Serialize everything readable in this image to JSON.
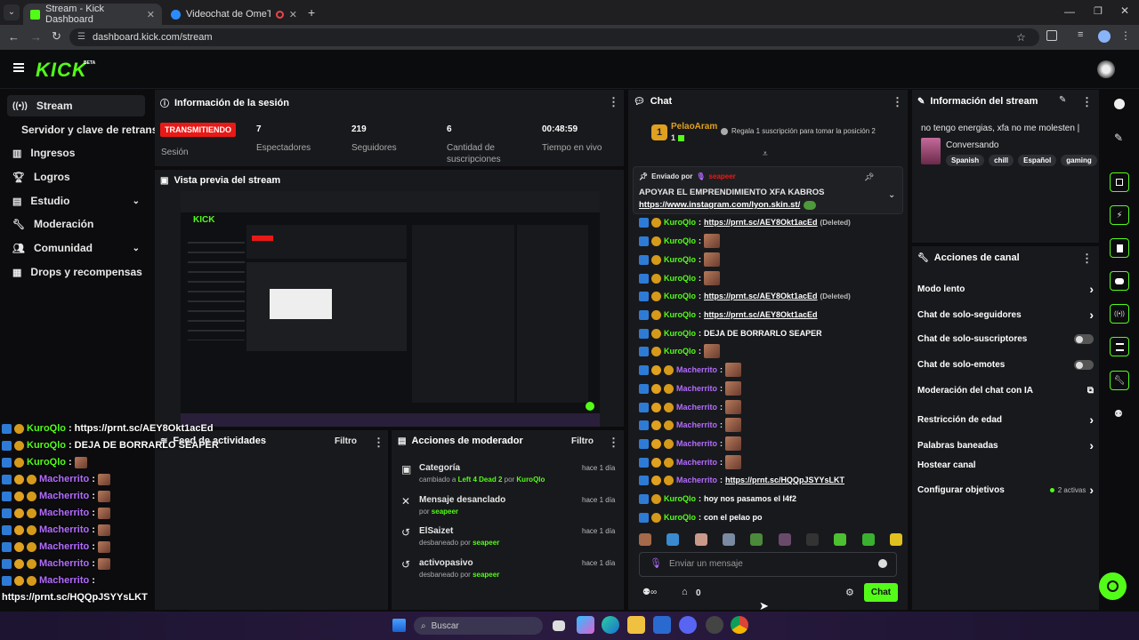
{
  "browser": {
    "tabs": [
      {
        "title": "Stream - Kick Dashboard"
      },
      {
        "title": "Videochat de OmeTV: una"
      }
    ],
    "url": "dashboard.kick.com/stream"
  },
  "brand": {
    "logo": "KICK",
    "beta": "BETA",
    "accent": "#53fc18"
  },
  "sidebar": {
    "items": [
      {
        "label": "Stream",
        "icon": "broadcast-icon"
      },
      {
        "label": "Servidor y clave de retransm"
      },
      {
        "label": "Ingresos",
        "icon": "chart-icon"
      },
      {
        "label": "Logros",
        "icon": "trophy-icon"
      },
      {
        "label": "Estudio",
        "icon": "studio-icon"
      },
      {
        "label": "Moderación",
        "icon": "wrench-icon"
      },
      {
        "label": "Comunidad",
        "icon": "community-icon"
      },
      {
        "label": "Drops y recompensas",
        "icon": "drops-icon"
      }
    ]
  },
  "session": {
    "title": "Información de la sesión",
    "status": "TRANSMITIENDO",
    "status_label": "Sesión",
    "stats": [
      {
        "value": "7",
        "label": "Espectadores"
      },
      {
        "value": "219",
        "label": "Seguidores"
      },
      {
        "value": "6",
        "label": "Cantidad de suscripciones"
      },
      {
        "value": "00:48:59",
        "label": "Tiempo en vivo"
      }
    ]
  },
  "preview": {
    "title": "Vista previa del stream"
  },
  "activity": {
    "title": "Feed de actividades",
    "filter": "Filtro"
  },
  "modactions": {
    "title": "Acciones de moderador",
    "filter": "Filtro",
    "items": [
      {
        "title": "Categoría",
        "pre": "cambiado a ",
        "target": "Left 4 Dead 2",
        "mid": " por ",
        "user": "KuroQlo",
        "time": "hace 1 día"
      },
      {
        "title": "Mensaje desanclado",
        "pre": "por ",
        "target": "",
        "mid": "",
        "user": "seapeer",
        "time": "hace 1 día"
      },
      {
        "title": "ElSaizet",
        "pre": "desbaneado por ",
        "target": "",
        "mid": "",
        "user": "seapeer",
        "time": "hace 1 día"
      },
      {
        "title": "activopasivo",
        "pre": "desbaneado por ",
        "target": "",
        "mid": "",
        "user": "seapeer",
        "time": "hace 1 día"
      }
    ]
  },
  "chat": {
    "title": "Chat",
    "gifter": {
      "rank": "1",
      "name": "PelaoAram",
      "count": "1",
      "cta": "Regala 1 suscripción para tomar la posición 2"
    },
    "pinned": {
      "label": "Enviado por",
      "user": "seapeer",
      "text": "APOYAR EL EMPRENDIMIENTO XFA KABROS",
      "link": "https://www.instagram.com/lyon.skin.st/"
    },
    "messages": [
      {
        "user": "KuroQlo",
        "color": "green",
        "text": "https://prnt.sc/AEY8Okt1acEd",
        "deleted": "(Deleted)",
        "emote": false,
        "sub": false
      },
      {
        "user": "KuroQlo",
        "color": "green",
        "text": "",
        "deleted": "",
        "emote": true,
        "sub": false
      },
      {
        "user": "KuroQlo",
        "color": "green",
        "text": "",
        "deleted": "",
        "emote": true,
        "sub": false
      },
      {
        "user": "KuroQlo",
        "color": "green",
        "text": "",
        "deleted": "",
        "emote": true,
        "sub": false
      },
      {
        "user": "KuroQlo",
        "color": "green",
        "text": "https://prnt.sc/AEY8Okt1acEd",
        "deleted": "(Deleted)",
        "emote": false,
        "sub": false
      },
      {
        "user": "KuroQlo",
        "color": "green",
        "text": "https://prnt.sc/AEY8Okt1acEd",
        "deleted": "",
        "emote": false,
        "sub": false
      },
      {
        "user": "KuroQlo",
        "color": "green",
        "text": "DEJA DE BORRARLO SEAPER",
        "deleted": "",
        "emote": false,
        "sub": false
      },
      {
        "user": "KuroQlo",
        "color": "green",
        "text": "",
        "deleted": "",
        "emote": true,
        "sub": false
      },
      {
        "user": "Macherrito",
        "color": "purple",
        "text": "",
        "deleted": "",
        "emote": true,
        "sub": true
      },
      {
        "user": "Macherrito",
        "color": "purple",
        "text": "",
        "deleted": "",
        "emote": true,
        "sub": true
      },
      {
        "user": "Macherrito",
        "color": "purple",
        "text": "",
        "deleted": "",
        "emote": true,
        "sub": true
      },
      {
        "user": "Macherrito",
        "color": "purple",
        "text": "",
        "deleted": "",
        "emote": true,
        "sub": true
      },
      {
        "user": "Macherrito",
        "color": "purple",
        "text": "",
        "deleted": "",
        "emote": true,
        "sub": true
      },
      {
        "user": "Macherrito",
        "color": "purple",
        "text": "",
        "deleted": "",
        "emote": true,
        "sub": true
      },
      {
        "user": "Macherrito",
        "color": "purple",
        "text": "https://prnt.sc/HQQpJSYYsLKT",
        "deleted": "",
        "emote": false,
        "sub": true
      },
      {
        "user": "KuroQlo",
        "color": "green",
        "text": "hoy nos pasamos el l4f2",
        "deleted": "",
        "emote": false,
        "sub": false
      },
      {
        "user": "KuroQlo",
        "color": "green",
        "text": "con el pelao po",
        "deleted": "",
        "emote": false,
        "sub": false
      }
    ],
    "input_placeholder": "Enviar un mensaje",
    "points": "0",
    "send_label": "Chat"
  },
  "stream_info": {
    "title": "Información del stream",
    "stream_title": "no tengo energias, xfa no me molesten |",
    "category": "Conversando",
    "tags": [
      "Spanish",
      "chill",
      "Español",
      "gaming"
    ]
  },
  "channel_actions": {
    "title": "Acciones de canal",
    "items": [
      {
        "label": "Modo lento",
        "control": "arrow"
      },
      {
        "label": "Chat de solo-seguidores",
        "control": "arrow"
      },
      {
        "label": "Chat de solo-suscriptores",
        "control": "toggle"
      },
      {
        "label": "Chat de solo-emotes",
        "control": "toggle"
      },
      {
        "label": "Moderación del chat con IA",
        "control": "external"
      },
      {
        "label": "Restricción de edad",
        "control": "arrow"
      },
      {
        "label": "Palabras baneadas",
        "control": "arrow"
      },
      {
        "label": "Hostear canal",
        "control": "none"
      },
      {
        "label": "Configurar objetivos",
        "control": "arrow",
        "extra": "2 activas"
      }
    ]
  },
  "overlay_chat": [
    {
      "user": "KuroQlo",
      "text": "https://prnt.sc/AEY8Okt1acEd",
      "sub": false
    },
    {
      "user": "KuroQlo",
      "text": "DEJA DE BORRARLO SEAPER",
      "sub": false
    },
    {
      "user": "KuroQlo",
      "text": "",
      "sub": false,
      "emote": true
    },
    {
      "user": "Macherrito",
      "text": "",
      "sub": true,
      "emote": true
    },
    {
      "user": "Macherrito",
      "text": "",
      "sub": true,
      "emote": true
    },
    {
      "user": "Macherrito",
      "text": "",
      "sub": true,
      "emote": true
    },
    {
      "user": "Macherrito",
      "text": "",
      "sub": true,
      "emote": true
    },
    {
      "user": "Macherrito",
      "text": "",
      "sub": true,
      "emote": true
    },
    {
      "user": "Macherrito",
      "text": "",
      "sub": true,
      "emote": true
    },
    {
      "user": "Macherrito",
      "text": "",
      "sub": true,
      "emote": false
    }
  ],
  "overlay_extra": {
    "link": "https://prnt.sc/HQQpJSYYsLKT",
    "lines": [
      {
        "user": "KuroQlo",
        "text": "hoy nos pasamos el l4f2"
      },
      {
        "user": "KuroQlo",
        "text": "con el pelao po"
      }
    ]
  },
  "taskbar": {
    "search_placeholder": "Buscar"
  }
}
